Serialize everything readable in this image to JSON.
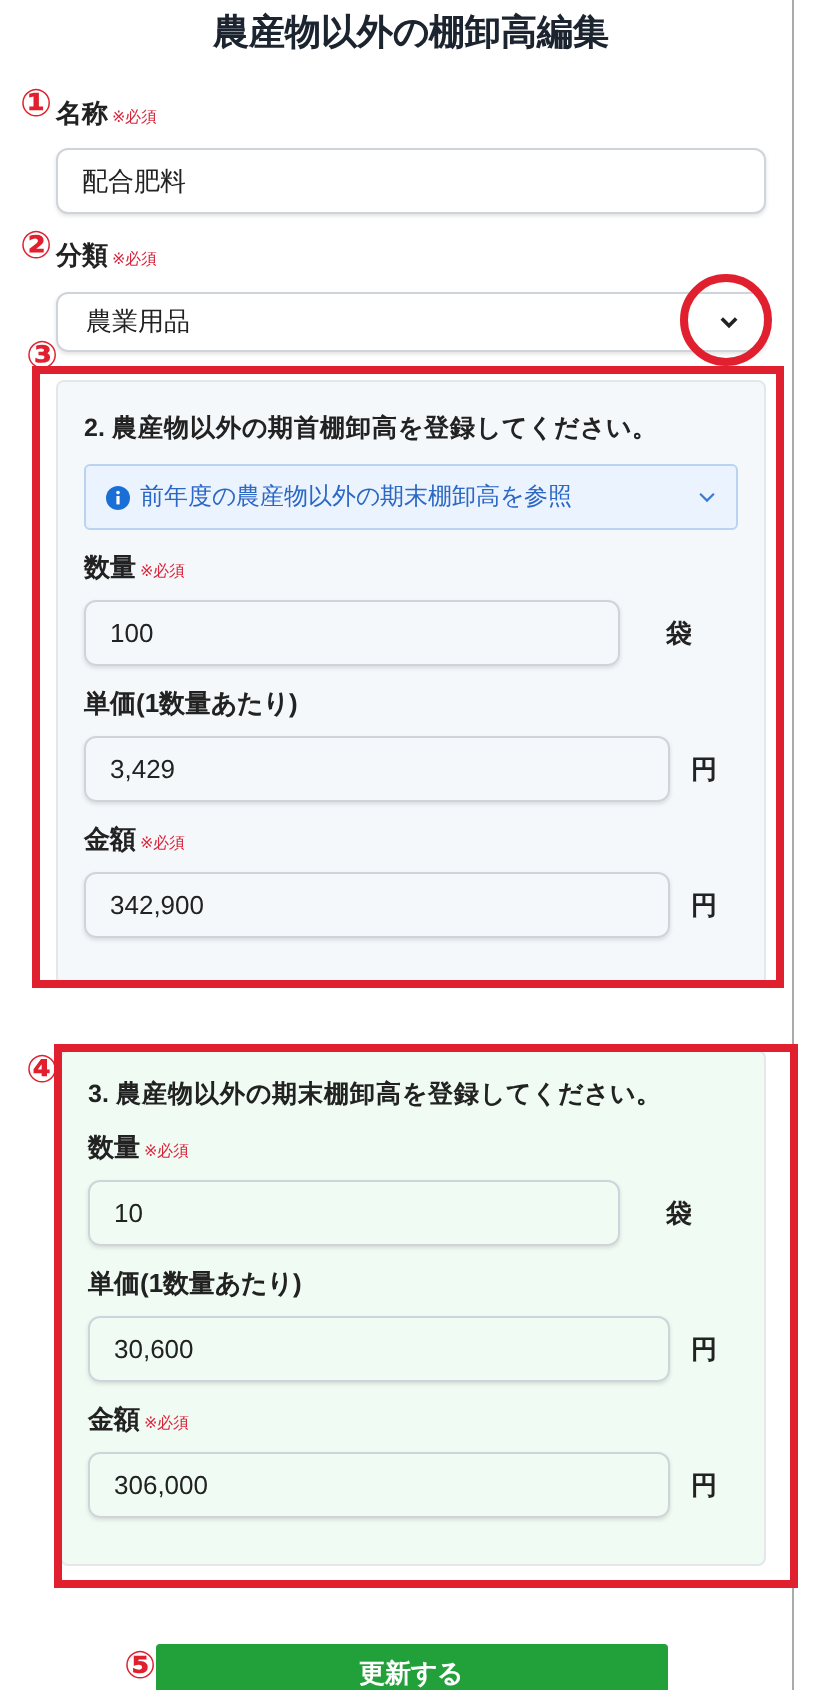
{
  "title": "農産物以外の棚卸高編集",
  "name_field": {
    "marker": "①",
    "label": "名称",
    "required": "※必須",
    "value": "配合肥料"
  },
  "category_field": {
    "marker": "②",
    "label": "分類",
    "required": "※必須",
    "value": "農業用品",
    "highlighted": true
  },
  "sections": [
    {
      "marker": "③",
      "kind": "opening",
      "highlighted": true,
      "title": "2. 農産物以外の期首棚卸高を登録してください。",
      "reference": {
        "text": "前年度の農産物以外の期末棚卸高を参照",
        "expanded": false
      },
      "fields": [
        {
          "kind": "quantity",
          "label": "数量",
          "required": "※必須",
          "value": "100",
          "unit": "袋"
        },
        {
          "kind": "money",
          "label": "単価(1数量あたり)",
          "value": "3,429",
          "unit": "円"
        },
        {
          "kind": "money",
          "label": "金額",
          "required": "※必須",
          "value": "342,900",
          "unit": "円"
        }
      ]
    },
    {
      "marker": "④",
      "kind": "closing",
      "highlighted": true,
      "title": "3. 農産物以外の期末棚卸高を登録してください。",
      "fields": [
        {
          "kind": "quantity",
          "label": "数量",
          "required": "※必須",
          "value": "10",
          "unit": "袋"
        },
        {
          "kind": "money",
          "label": "単価(1数量あたり)",
          "value": "30,600",
          "unit": "円"
        },
        {
          "kind": "money",
          "label": "金額",
          "required": "※必須",
          "value": "306,000",
          "unit": "円"
        }
      ]
    }
  ],
  "submit": {
    "marker": "⑤",
    "label": "更新する"
  }
}
